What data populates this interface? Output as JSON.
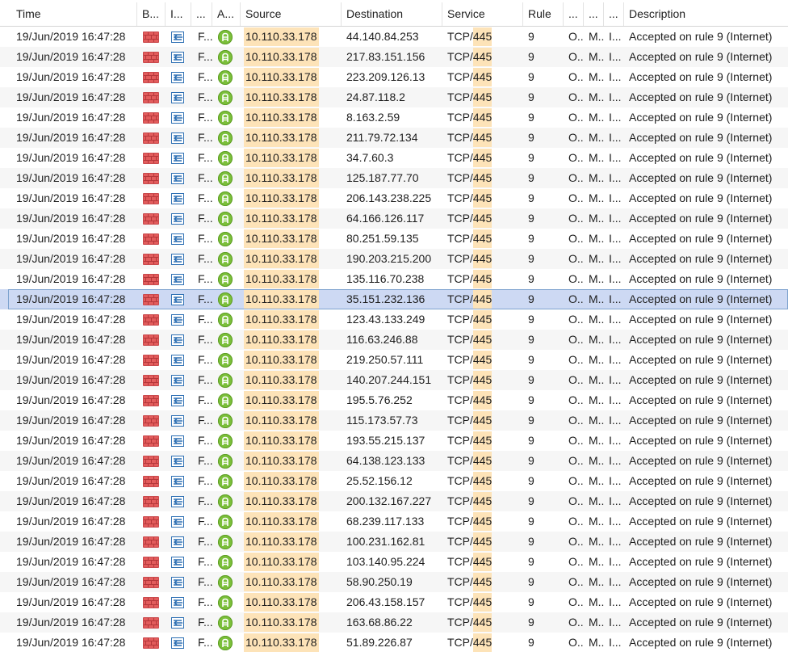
{
  "columns": [
    "Time",
    "B...",
    "I...",
    "...",
    "A...",
    "Source",
    "Destination",
    "Service",
    "Rule",
    "...",
    "...",
    "...",
    "Description"
  ],
  "colors": {
    "highlight": "#fde3b8",
    "selected_row": "#cdd9f3",
    "firewall_icon": "#e25c5c",
    "accept_icon": "#7bbf3a"
  },
  "row_template": {
    "time": "19/Jun/2019 16:47:28",
    "blade_icon": "firewall-icon",
    "interface_icon": "inbound-arrow-icon",
    "origin": "F...",
    "action_icon": "accept-icon",
    "source": "10.110.33.178",
    "service_proto": "TCP/",
    "service_port": "445",
    "rule": "9",
    "c1": "O..",
    "c2": "M..",
    "c3": "I...",
    "description": "Accepted on rule 9 (Internet)"
  },
  "selected_index": 13,
  "destinations": [
    "44.140.84.253",
    "217.83.151.156",
    "223.209.126.13",
    "24.87.118.2",
    "8.163.2.59",
    "211.79.72.134",
    "34.7.60.3",
    "125.187.77.70",
    "206.143.238.225",
    "64.166.126.117",
    "80.251.59.135",
    "190.203.215.200",
    "135.116.70.238",
    "35.151.232.136",
    "123.43.133.249",
    "116.63.246.88",
    "219.250.57.111",
    "140.207.244.151",
    "195.5.76.252",
    "115.173.57.73",
    "193.55.215.137",
    "64.138.123.133",
    "25.52.156.12",
    "200.132.167.227",
    "68.239.117.133",
    "100.231.162.81",
    "103.140.95.224",
    "58.90.250.19",
    "206.43.158.157",
    "163.68.86.22",
    "51.89.226.87"
  ]
}
